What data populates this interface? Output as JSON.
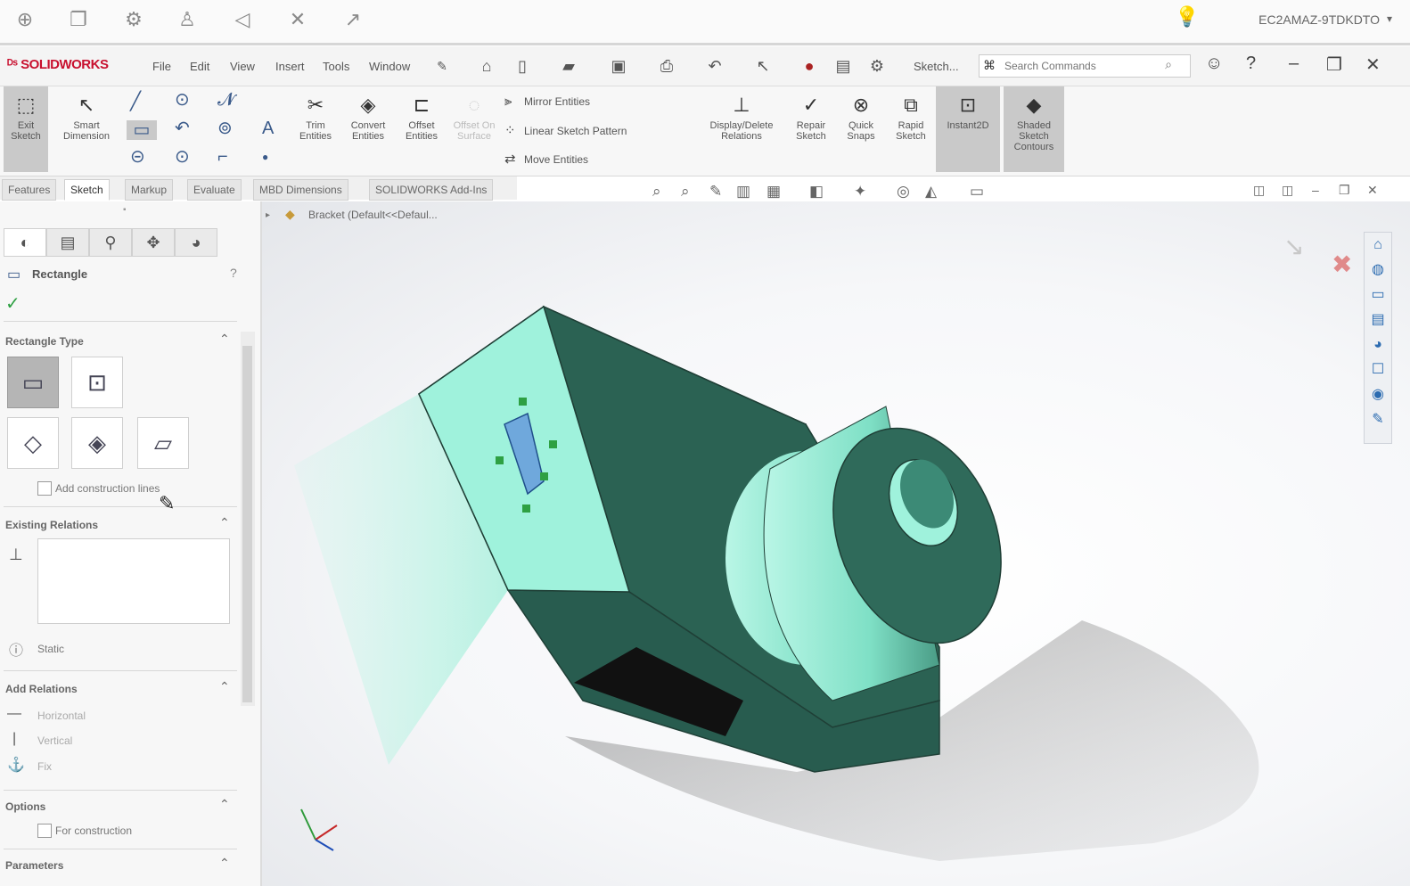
{
  "system": {
    "machine_name": "EC2AMAZ-9TDKDTO",
    "icons": [
      "navigate-icon",
      "cube-icon",
      "gear-icon",
      "person-icon",
      "speaker-icon",
      "expand-icon",
      "pointer-icon"
    ]
  },
  "app": {
    "logo_text": "SOLIDWORKS"
  },
  "menu": {
    "items": [
      "File",
      "Edit",
      "View",
      "Insert",
      "Tools",
      "Window"
    ],
    "sketch_dropdown": "Sketch..."
  },
  "search": {
    "placeholder": "Search Commands"
  },
  "commands": {
    "exit_sketch": "Exit Sketch",
    "smart_dimension": "Smart Dimension",
    "trim_entities": "Trim Entities",
    "convert_entities": "Convert Entities",
    "offset_entities": "Offset Entities",
    "offset_on_surface": "Offset On Surface",
    "mirror_entities": "Mirror Entities",
    "linear_sketch_pattern": "Linear Sketch Pattern",
    "move_entities": "Move Entities",
    "display_delete_relations": "Display/Delete Relations",
    "repair_sketch": "Repair Sketch",
    "quick_snaps": "Quick Snaps",
    "rapid_sketch": "Rapid Sketch",
    "instant2d": "Instant2D",
    "shaded_sketch_contours": "Shaded Sketch Contours"
  },
  "tabs": [
    "Features",
    "Sketch",
    "Markup",
    "Evaluate",
    "MBD Dimensions",
    "SOLIDWORKS Add-Ins"
  ],
  "active_tab": "Sketch",
  "tree": {
    "label": "Bracket (Default<<Defaul..."
  },
  "property_manager": {
    "title": "Rectangle",
    "rectangle_type": "Rectangle Type",
    "add_construction_lines": "Add construction lines",
    "existing_relations": "Existing Relations",
    "status": "Static",
    "add_relations": "Add Relations",
    "relations": [
      "Horizontal",
      "Vertical",
      "Fix"
    ],
    "options": "Options",
    "for_construction": "For construction",
    "parameters": "Parameters"
  },
  "colors": {
    "face_light": "#9ff2dc",
    "face_dark": "#2f6a5a",
    "edge": "#1f3f36",
    "sketch_rect": "#6fa8dc",
    "accent_red": "#c8102e"
  }
}
